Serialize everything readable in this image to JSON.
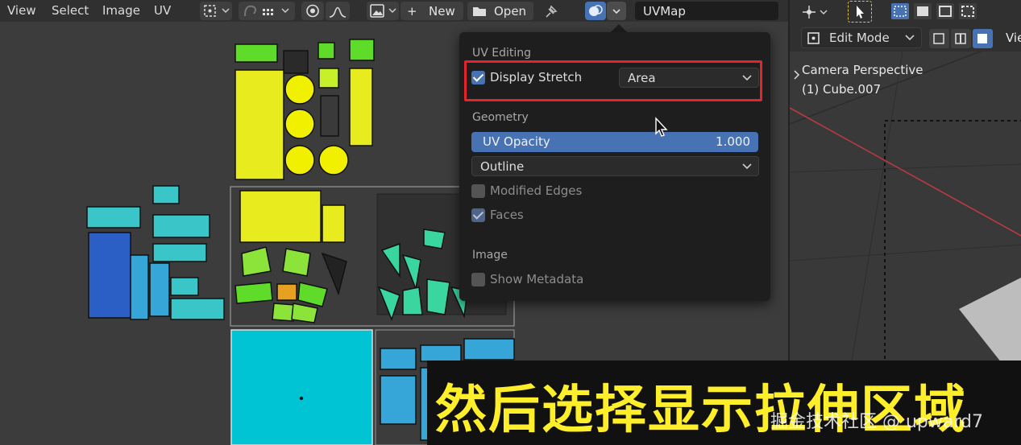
{
  "header": {
    "menus": [
      "View",
      "Select",
      "Image",
      "UV"
    ],
    "new_label": "New",
    "open_label": "Open",
    "uvmap": "UVMap"
  },
  "popover": {
    "uv_editing": {
      "title": "UV Editing",
      "display_stretch_label": "Display Stretch",
      "display_stretch_checked": true,
      "stretch_mode": "Area"
    },
    "geometry": {
      "title": "Geometry",
      "uv_opacity_label": "UV Opacity",
      "uv_opacity_value": "1.000",
      "edge_mode": "Outline",
      "modified_edges_label": "Modified Edges",
      "modified_edges_checked": false,
      "faces_label": "Faces",
      "faces_checked": true
    },
    "image": {
      "title": "Image",
      "show_metadata_label": "Show Metadata",
      "show_metadata_checked": false
    }
  },
  "viewport": {
    "mode": "Edit Mode",
    "view_menu": "Vie",
    "camera_label": "Camera Perspective",
    "object_label": "(1) Cube.007"
  },
  "subtitle": {
    "text": "然后选择显示拉伸区域",
    "watermark": "掘金技术社区 @ upward7"
  },
  "colors": {
    "accent": "#4772b3",
    "highlight_box": "#e3242b",
    "subtitle": "#ffef2a",
    "uv_yellow": "#f0f000",
    "uv_cyan": "#00c4d4",
    "uv_blue": "#2b5fc6"
  }
}
